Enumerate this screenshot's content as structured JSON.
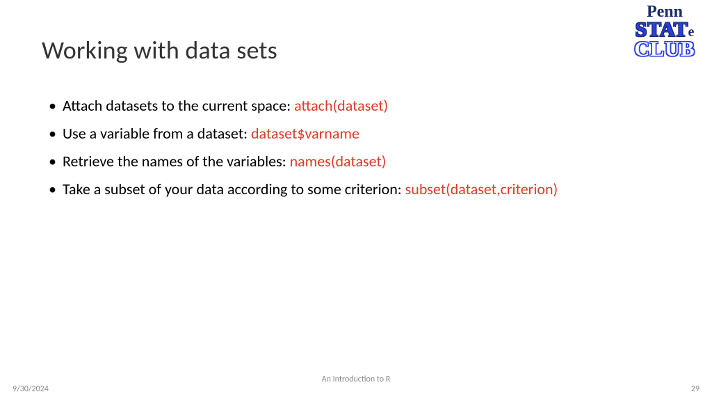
{
  "slide": {
    "title": "Working with data sets",
    "bullets": [
      {
        "text": "Attach datasets to the current space: ",
        "code": "attach(dataset)"
      },
      {
        "text": "Use a variable from a dataset: ",
        "code": "dataset$varname"
      },
      {
        "text": "Retrieve the names of the variables: ",
        "code": "names(dataset)"
      },
      {
        "text": "Take a subset of your data according to some criterion: ",
        "code": "subset(dataset,criterion)"
      }
    ]
  },
  "logo": {
    "line1": "Penn",
    "line2_stat": "STAT",
    "line2_e": "e",
    "line3": "CLUB"
  },
  "footer": {
    "date": "9/30/2024",
    "center": "An Introduction to R",
    "page": "29"
  }
}
